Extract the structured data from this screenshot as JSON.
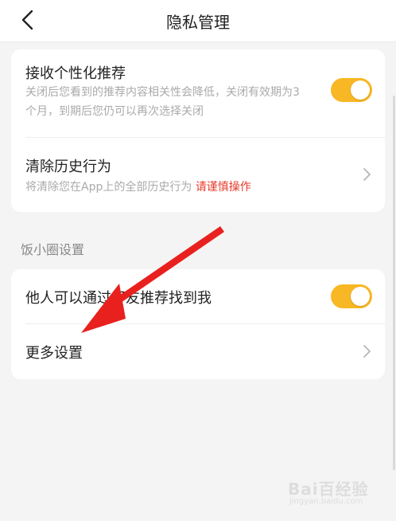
{
  "header": {
    "title": "隐私管理"
  },
  "personalized": {
    "title": "接收个性化推荐",
    "desc": "关闭后您看到的推荐内容相关性会降低，关闭有效期为3个月，到期后您仍可以再次选择关闭",
    "enabled": true
  },
  "clear_history": {
    "title": "清除历史行为",
    "desc": "将清除您在App上的全部历史行为",
    "warning": "请谨慎操作"
  },
  "section": {
    "label": "饭小圈设置"
  },
  "friend_recommend": {
    "title": "他人可以通过好友推荐找到我",
    "enabled": true
  },
  "more_settings": {
    "title": "更多设置"
  },
  "watermark": {
    "text": "Bai百经验",
    "sub": "jingyan.baidu.com"
  },
  "colors": {
    "accent": "#f8b724",
    "warning": "#e8392b",
    "arrow": "#e8211f"
  }
}
